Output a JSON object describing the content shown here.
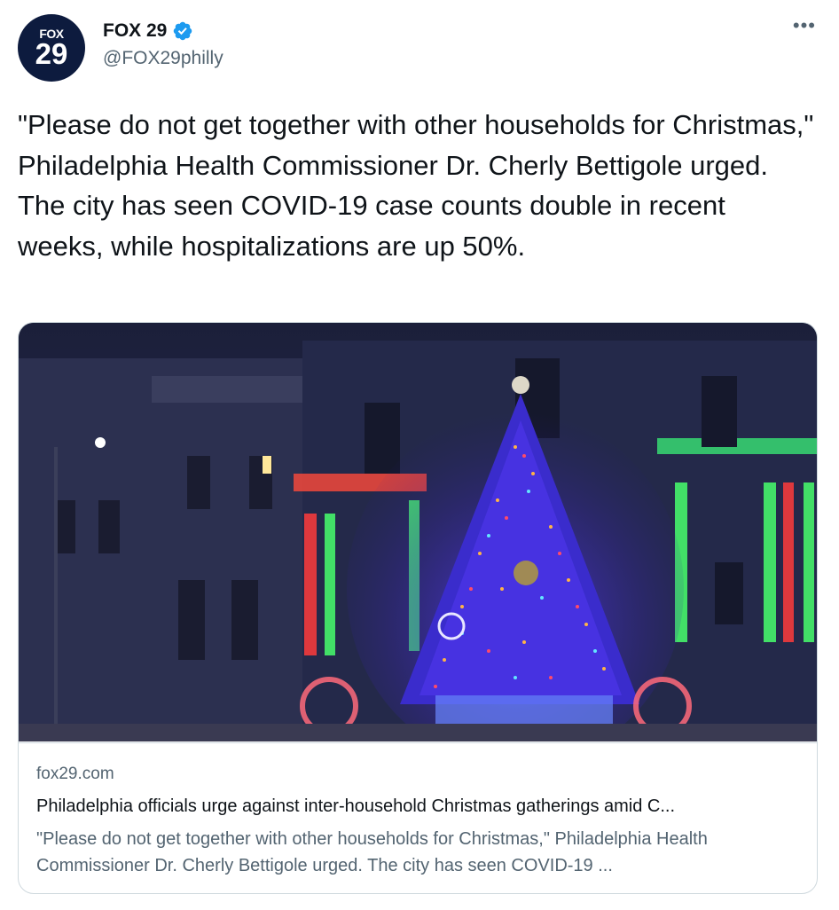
{
  "account": {
    "display_name": "FOX 29",
    "handle": "@FOX29philly",
    "avatar_top": "FOX",
    "avatar_bottom": "29",
    "verified_color": "#1d9bf0",
    "avatar_color": "#0d1b3e"
  },
  "more_menu": {
    "label": "•••",
    "icon": "more-horizontal-icon"
  },
  "tweet": {
    "text": "\"Please do not get together with other households for Christmas,\" Philadelphia Health Commissioner Dr. Cherly Bettigole urged. The city has seen COVID-19 case counts double in recent weeks, while hospitalizations are up 50%."
  },
  "card": {
    "image_description_icon": "christmas-tree-city-hall-photo",
    "domain": "fox29.com",
    "title": "Philadelphia officials urge against inter-household Christmas gatherings amid C...",
    "description": "\"Please do not get together with other households for Christmas,\" Philadelphia Health Commissioner Dr. Cherly Bettigole urged. The city has seen COVID-19 ..."
  }
}
